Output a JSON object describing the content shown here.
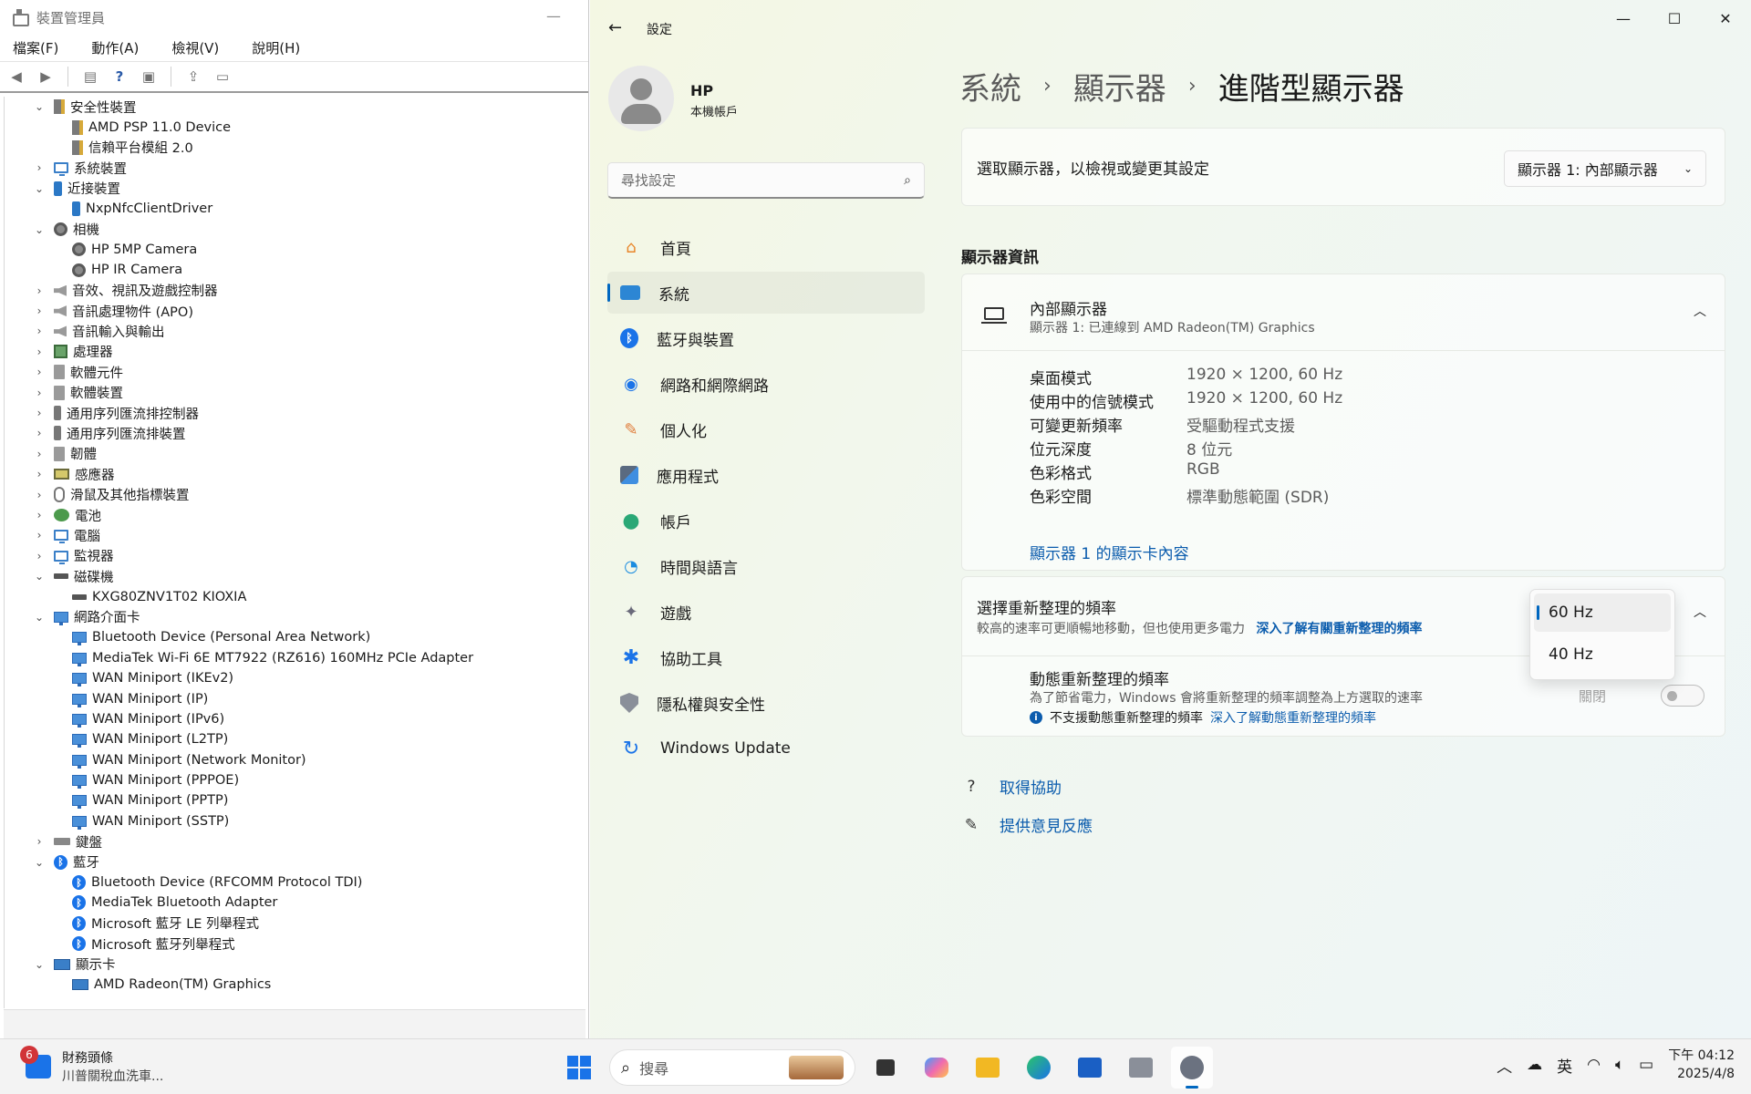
{
  "device_manager": {
    "title": "裝置管理員",
    "menu": [
      "檔案(F)",
      "動作(A)",
      "檢視(V)",
      "說明(H)"
    ],
    "tree": [
      {
        "label": "安全性裝置",
        "level": 0,
        "expanded": true,
        "icon": "security-device-icon"
      },
      {
        "label": "AMD PSP 11.0 Device",
        "level": 1,
        "icon": "security-device-icon"
      },
      {
        "label": "信賴平台模組 2.0",
        "level": 1,
        "icon": "security-device-icon"
      },
      {
        "label": "系統裝置",
        "level": 0,
        "expanded": false,
        "icon": "system-device-icon"
      },
      {
        "label": "近接裝置",
        "level": 0,
        "expanded": true,
        "icon": "proximity-device-icon"
      },
      {
        "label": "NxpNfcClientDriver",
        "level": 1,
        "icon": "proximity-device-icon"
      },
      {
        "label": "相機",
        "level": 0,
        "expanded": true,
        "icon": "camera-icon"
      },
      {
        "label": "HP 5MP Camera",
        "level": 1,
        "icon": "camera-icon"
      },
      {
        "label": "HP IR Camera",
        "level": 1,
        "icon": "camera-icon"
      },
      {
        "label": "音效、視訊及遊戲控制器",
        "level": 0,
        "expanded": false,
        "icon": "speaker-icon"
      },
      {
        "label": "音訊處理物件 (APO)",
        "level": 0,
        "expanded": false,
        "icon": "speaker-icon"
      },
      {
        "label": "音訊輸入與輸出",
        "level": 0,
        "expanded": false,
        "icon": "speaker-icon"
      },
      {
        "label": "處理器",
        "level": 0,
        "expanded": false,
        "icon": "processor-icon"
      },
      {
        "label": "軟體元件",
        "level": 0,
        "expanded": false,
        "icon": "software-component-icon"
      },
      {
        "label": "軟體裝置",
        "level": 0,
        "expanded": false,
        "icon": "software-device-icon"
      },
      {
        "label": "通用序列匯流排控制器",
        "level": 0,
        "expanded": false,
        "icon": "usb-icon"
      },
      {
        "label": "通用序列匯流排裝置",
        "level": 0,
        "expanded": false,
        "icon": "usb-icon"
      },
      {
        "label": "韌體",
        "level": 0,
        "expanded": false,
        "icon": "firmware-icon"
      },
      {
        "label": "感應器",
        "level": 0,
        "expanded": false,
        "icon": "sensor-icon"
      },
      {
        "label": "滑鼠及其他指標裝置",
        "level": 0,
        "expanded": false,
        "icon": "mouse-icon"
      },
      {
        "label": "電池",
        "level": 0,
        "expanded": false,
        "icon": "battery-icon"
      },
      {
        "label": "電腦",
        "level": 0,
        "expanded": false,
        "icon": "computer-icon"
      },
      {
        "label": "監視器",
        "level": 0,
        "expanded": false,
        "icon": "monitor-icon"
      },
      {
        "label": "磁碟機",
        "level": 0,
        "expanded": true,
        "icon": "disk-drive-icon"
      },
      {
        "label": "KXG80ZNV1T02 KIOXIA",
        "level": 1,
        "icon": "disk-drive-icon"
      },
      {
        "label": "網路介面卡",
        "level": 0,
        "expanded": true,
        "icon": "network-adapter-icon"
      },
      {
        "label": "Bluetooth Device (Personal Area Network)",
        "level": 1,
        "icon": "network-adapter-icon"
      },
      {
        "label": "MediaTek Wi-Fi 6E MT7922 (RZ616) 160MHz PCIe Adapter",
        "level": 1,
        "icon": "network-adapter-icon"
      },
      {
        "label": "WAN Miniport (IKEv2)",
        "level": 1,
        "icon": "network-adapter-icon"
      },
      {
        "label": "WAN Miniport (IP)",
        "level": 1,
        "icon": "network-adapter-icon"
      },
      {
        "label": "WAN Miniport (IPv6)",
        "level": 1,
        "icon": "network-adapter-icon"
      },
      {
        "label": "WAN Miniport (L2TP)",
        "level": 1,
        "icon": "network-adapter-icon"
      },
      {
        "label": "WAN Miniport (Network Monitor)",
        "level": 1,
        "icon": "network-adapter-icon"
      },
      {
        "label": "WAN Miniport (PPPOE)",
        "level": 1,
        "icon": "network-adapter-icon"
      },
      {
        "label": "WAN Miniport (PPTP)",
        "level": 1,
        "icon": "network-adapter-icon"
      },
      {
        "label": "WAN Miniport (SSTP)",
        "level": 1,
        "icon": "network-adapter-icon"
      },
      {
        "label": "鍵盤",
        "level": 0,
        "expanded": false,
        "icon": "keyboard-icon"
      },
      {
        "label": "藍牙",
        "level": 0,
        "expanded": true,
        "icon": "bluetooth-icon"
      },
      {
        "label": "Bluetooth Device (RFCOMM Protocol TDI)",
        "level": 1,
        "icon": "bluetooth-icon"
      },
      {
        "label": "MediaTek Bluetooth Adapter",
        "level": 1,
        "icon": "bluetooth-icon"
      },
      {
        "label": "Microsoft 藍牙 LE 列舉程式",
        "level": 1,
        "icon": "bluetooth-icon"
      },
      {
        "label": "Microsoft 藍牙列舉程式",
        "level": 1,
        "icon": "bluetooth-icon"
      },
      {
        "label": "顯示卡",
        "level": 0,
        "expanded": true,
        "icon": "display-adapter-icon"
      },
      {
        "label": "AMD Radeon(TM) Graphics",
        "level": 1,
        "icon": "display-adapter-icon"
      }
    ]
  },
  "settings": {
    "app_title": "設定",
    "profile": {
      "name": "HP",
      "subtitle": "本機帳戶"
    },
    "search_placeholder": "尋找設定",
    "nav": [
      {
        "label": "首頁",
        "icon": "home-icon",
        "active": false
      },
      {
        "label": "系統",
        "icon": "system-icon",
        "active": true
      },
      {
        "label": "藍牙與裝置",
        "icon": "bluetooth-icon",
        "active": false
      },
      {
        "label": "網路和網際網路",
        "icon": "wifi-icon",
        "active": false
      },
      {
        "label": "個人化",
        "icon": "brush-icon",
        "active": false
      },
      {
        "label": "應用程式",
        "icon": "apps-icon",
        "active": false
      },
      {
        "label": "帳戶",
        "icon": "account-icon",
        "active": false
      },
      {
        "label": "時間與語言",
        "icon": "time-language-icon",
        "active": false
      },
      {
        "label": "遊戲",
        "icon": "gaming-icon",
        "active": false
      },
      {
        "label": "協助工具",
        "icon": "accessibility-icon",
        "active": false
      },
      {
        "label": "隱私權與安全性",
        "icon": "privacy-shield-icon",
        "active": false
      },
      {
        "label": "Windows Update",
        "icon": "windows-update-icon",
        "active": false
      }
    ],
    "breadcrumb": [
      "系統",
      "顯示器",
      "進階型顯示器"
    ],
    "select_display": {
      "label": "選取顯示器，以檢視或變更其設定",
      "value": "顯示器 1: 內部顯示器"
    },
    "info_section_title": "顯示器資訊",
    "display_info": {
      "title": "內部顯示器",
      "subtitle": "顯示器 1: 已連線到 AMD Radeon(TM) Graphics",
      "rows": [
        {
          "key": "桌面模式",
          "value": "1920 × 1200, 60 Hz"
        },
        {
          "key": "使用中的信號模式",
          "value": "1920 × 1200, 60 Hz"
        },
        {
          "key": "可變更新頻率",
          "value": "受驅動程式支援"
        },
        {
          "key": "位元深度",
          "value": "8 位元"
        },
        {
          "key": "色彩格式",
          "value": "RGB"
        },
        {
          "key": "色彩空間",
          "value": "標準動態範圍 (SDR)"
        }
      ],
      "adapter_link": "顯示器 1 的顯示卡內容"
    },
    "refresh": {
      "title": "選擇重新整理的頻率",
      "subtitle": "較高的速率可更順暢地移動，但也使用更多電力",
      "learn_more": "深入了解有關重新整理的頻率",
      "options": [
        "60 Hz",
        "40 Hz"
      ],
      "selected": "60 Hz",
      "dynamic_title": "動態重新整理的頻率",
      "dynamic_subtitle": "為了節省電力，Windows 會將重新整理的頻率調整為上方選取的速率",
      "dynamic_warning": "不支援動態重新整理的頻率",
      "dynamic_learn_more": "深入了解動態重新整理的頻率",
      "toggle_label": "關閉"
    },
    "footer": {
      "help": "取得協助",
      "feedback": "提供意見反應"
    }
  },
  "taskbar": {
    "news_badge": "6",
    "news_title": "財務頭條",
    "news_subtitle": "川普關稅血洗車...",
    "search_placeholder": "搜尋",
    "ime": "英",
    "time": "下午 04:12",
    "date": "2025/4/8"
  },
  "colors": {
    "accent": "#0067c0",
    "link": "#0b5cad",
    "badge": "#d13438"
  }
}
